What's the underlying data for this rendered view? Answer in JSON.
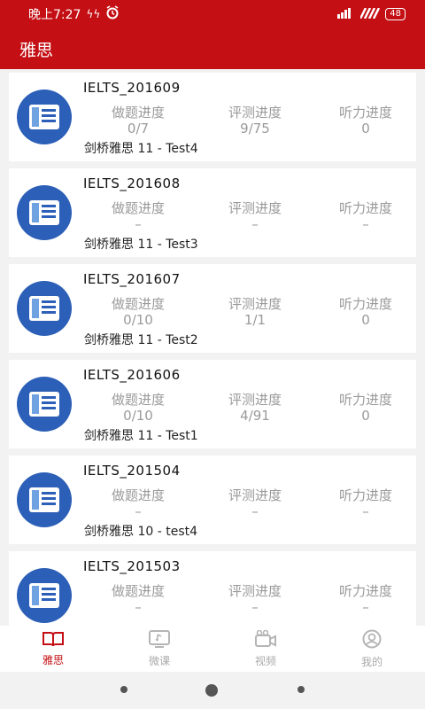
{
  "status_bar": {
    "time": "晚上7:27",
    "battery": "48"
  },
  "header": {
    "title": "雅思"
  },
  "labels": {
    "practice": "做题进度",
    "evaluation": "评测进度",
    "listening": "听力进度"
  },
  "cards": [
    {
      "title": "IELTS_201609",
      "practice": "0/7",
      "evaluation": "9/75",
      "listening": "0",
      "subtitle": "剑桥雅思 11 - Test4"
    },
    {
      "title": "IELTS_201608",
      "practice": "–",
      "evaluation": "–",
      "listening": "–",
      "subtitle": "剑桥雅思 11 - Test3"
    },
    {
      "title": "IELTS_201607",
      "practice": "0/10",
      "evaluation": "1/1",
      "listening": "0",
      "subtitle": "剑桥雅思 11 - Test2"
    },
    {
      "title": "IELTS_201606",
      "practice": "0/10",
      "evaluation": "4/91",
      "listening": "0",
      "subtitle": "剑桥雅思 11 - Test1"
    },
    {
      "title": "IELTS_201504",
      "practice": "–",
      "evaluation": "–",
      "listening": "–",
      "subtitle": "剑桥雅思 10 - test4"
    },
    {
      "title": "IELTS_201503",
      "practice": "–",
      "evaluation": "–",
      "listening": "–",
      "subtitle": ""
    }
  ],
  "tabs": [
    {
      "label": "雅思",
      "icon": "book-icon",
      "active": true
    },
    {
      "label": "微课",
      "icon": "micro-lesson-icon",
      "active": false
    },
    {
      "label": "视频",
      "icon": "video-camera-icon",
      "active": false
    },
    {
      "label": "我的",
      "icon": "profile-icon",
      "active": false
    }
  ],
  "colors": {
    "primary": "#c40f14",
    "icon_blue": "#2c5fb7",
    "muted_text": "#9a9a9a"
  }
}
